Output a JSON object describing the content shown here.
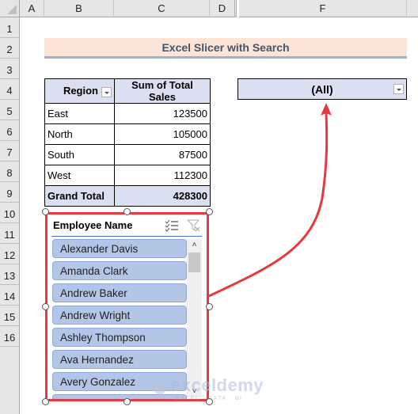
{
  "columns": [
    "A",
    "B",
    "C",
    "D",
    "F"
  ],
  "rows": [
    "1",
    "2",
    "3",
    "4",
    "5",
    "6",
    "7",
    "8",
    "9",
    "10",
    "11",
    "12",
    "13",
    "14",
    "15",
    "16"
  ],
  "title": "Excel Slicer with Search",
  "pivot": {
    "headers": [
      "Region",
      "Sum of Total Sales"
    ],
    "rows": [
      {
        "region": "East",
        "sales": "123500"
      },
      {
        "region": "North",
        "sales": "105000"
      },
      {
        "region": "South",
        "sales": "87500"
      },
      {
        "region": "West",
        "sales": "112300"
      }
    ],
    "total": {
      "label": "Grand Total",
      "value": "428300"
    }
  },
  "report_filter": {
    "value": "(All)"
  },
  "slicer": {
    "title": "Employee Name",
    "items": [
      "Alexander Davis",
      "Amanda Clark",
      "Andrew Baker",
      "Andrew Wright",
      "Ashley Thompson",
      "Ava Hernandez",
      "Avery Gonzalez"
    ],
    "icons": [
      "multi-select-icon",
      "clear-filter-icon"
    ]
  },
  "annotation": {
    "arrow_color": "#e8393f",
    "selection_color": "#e8393f"
  },
  "watermark": {
    "brand": "exceldemy",
    "tagline": "EXCEL · DATA · BI"
  }
}
